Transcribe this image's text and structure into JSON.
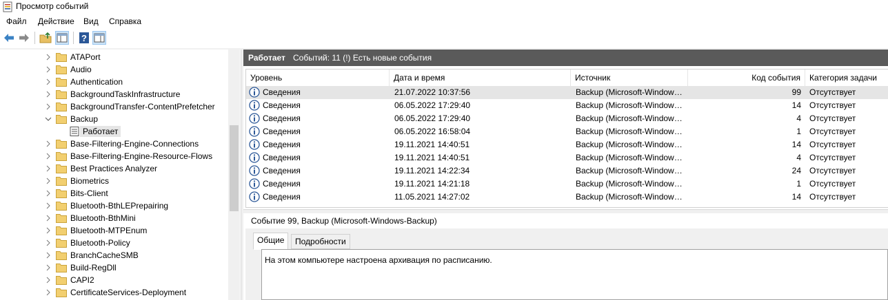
{
  "window": {
    "title": "Просмотр событий"
  },
  "menu": [
    "Файл",
    "Действие",
    "Вид",
    "Справка"
  ],
  "tree": {
    "items": [
      {
        "label": "ATAPort",
        "state": "collapsed"
      },
      {
        "label": "Audio",
        "state": "collapsed"
      },
      {
        "label": "Authentication",
        "state": "collapsed"
      },
      {
        "label": "BackgroundTaskInfrastructure",
        "state": "collapsed"
      },
      {
        "label": "BackgroundTransfer-ContentPrefetcher",
        "state": "collapsed"
      },
      {
        "label": "Backup",
        "state": "expanded"
      },
      {
        "label": "Работает",
        "state": "log",
        "selected": true
      },
      {
        "label": "Base-Filtering-Engine-Connections",
        "state": "collapsed"
      },
      {
        "label": "Base-Filtering-Engine-Resource-Flows",
        "state": "collapsed"
      },
      {
        "label": "Best Practices Analyzer",
        "state": "collapsed"
      },
      {
        "label": "Biometrics",
        "state": "collapsed"
      },
      {
        "label": "Bits-Client",
        "state": "collapsed"
      },
      {
        "label": "Bluetooth-BthLEPrepairing",
        "state": "collapsed"
      },
      {
        "label": "Bluetooth-BthMini",
        "state": "collapsed"
      },
      {
        "label": "Bluetooth-MTPEnum",
        "state": "collapsed"
      },
      {
        "label": "Bluetooth-Policy",
        "state": "collapsed"
      },
      {
        "label": "BranchCacheSMB",
        "state": "collapsed"
      },
      {
        "label": "Build-RegDll",
        "state": "collapsed"
      },
      {
        "label": "CAPI2",
        "state": "collapsed"
      },
      {
        "label": "CertificateServices-Deployment",
        "state": "collapsed"
      }
    ]
  },
  "log": {
    "name": "Работает",
    "summary": "Событий: 11 (!) Есть новые события",
    "columns": [
      "Уровень",
      "Дата и время",
      "Источник",
      "Код события",
      "Категория задачи"
    ],
    "rows": [
      {
        "level": "Сведения",
        "datetime": "21.07.2022 10:37:56",
        "source": "Backup (Microsoft-Window…",
        "code": "99",
        "category": "Отсутствует"
      },
      {
        "level": "Сведения",
        "datetime": "06.05.2022 17:29:40",
        "source": "Backup (Microsoft-Window…",
        "code": "14",
        "category": "Отсутствует"
      },
      {
        "level": "Сведения",
        "datetime": "06.05.2022 17:29:40",
        "source": "Backup (Microsoft-Window…",
        "code": "4",
        "category": "Отсутствует"
      },
      {
        "level": "Сведения",
        "datetime": "06.05.2022 16:58:04",
        "source": "Backup (Microsoft-Window…",
        "code": "1",
        "category": "Отсутствует"
      },
      {
        "level": "Сведения",
        "datetime": "19.11.2021 14:40:51",
        "source": "Backup (Microsoft-Window…",
        "code": "14",
        "category": "Отсутствует"
      },
      {
        "level": "Сведения",
        "datetime": "19.11.2021 14:40:51",
        "source": "Backup (Microsoft-Window…",
        "code": "4",
        "category": "Отсутствует"
      },
      {
        "level": "Сведения",
        "datetime": "19.11.2021 14:22:34",
        "source": "Backup (Microsoft-Window…",
        "code": "24",
        "category": "Отсутствует"
      },
      {
        "level": "Сведения",
        "datetime": "19.11.2021 14:21:18",
        "source": "Backup (Microsoft-Window…",
        "code": "1",
        "category": "Отсутствует"
      },
      {
        "level": "Сведения",
        "datetime": "11.05.2021 14:27:02",
        "source": "Backup (Microsoft-Window…",
        "code": "14",
        "category": "Отсутствует"
      }
    ]
  },
  "detail": {
    "title": "Событие 99, Backup (Microsoft-Windows-Backup)",
    "tabs": [
      "Общие",
      "Подробности"
    ],
    "message": "На этом компьютере настроена архивация по расписанию."
  },
  "colors": {
    "header_bar": "#5a5a5a",
    "selection": "#e5e5e5",
    "info_icon": "#2b5797",
    "folder": "#e8c064"
  },
  "icons": [
    "back-arrow-icon",
    "forward-arrow-icon",
    "up-folder-icon",
    "show-tree-icon",
    "help-icon",
    "action-pane-icon",
    "folder-icon",
    "log-icon",
    "info-icon",
    "chevron-right-icon",
    "chevron-down-icon"
  ]
}
